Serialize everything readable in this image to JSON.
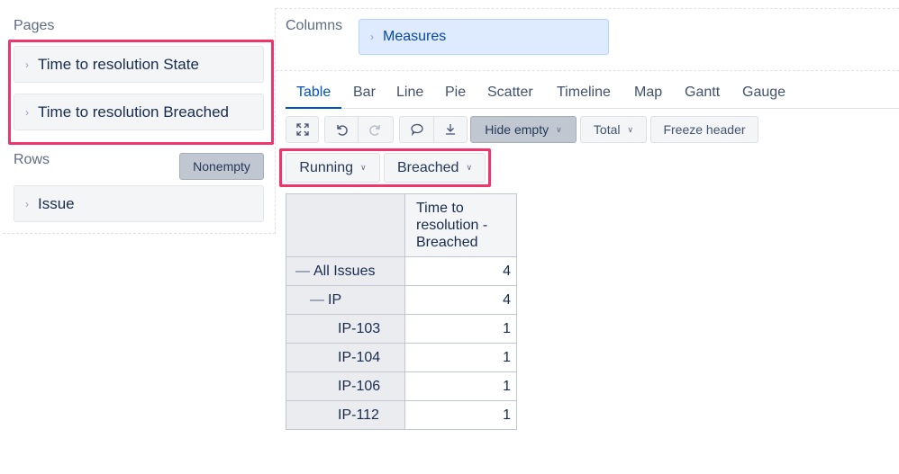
{
  "left": {
    "pages_title": "Pages",
    "pages_items": [
      "Time to resolution State",
      "Time to resolution Breached"
    ],
    "rows_title": "Rows",
    "nonempty_label": "Nonempty",
    "rows_items": [
      "Issue"
    ]
  },
  "columns": {
    "title": "Columns",
    "measures_label": "Measures"
  },
  "tabs": [
    "Table",
    "Bar",
    "Line",
    "Pie",
    "Scatter",
    "Timeline",
    "Map",
    "Gantt",
    "Gauge"
  ],
  "active_tab": "Table",
  "toolbar": {
    "hide_empty_label": "Hide empty",
    "total_label": "Total",
    "freeze_header_label": "Freeze header"
  },
  "filters": {
    "running_label": "Running",
    "breached_label": "Breached"
  },
  "table": {
    "column_header": "Time to resolution - Breached",
    "rows": [
      {
        "label": "All Issues",
        "value": "4"
      },
      {
        "label": "IP",
        "value": "4"
      },
      {
        "label": "IP-103",
        "value": "1"
      },
      {
        "label": "IP-104",
        "value": "1"
      },
      {
        "label": "IP-106",
        "value": "1"
      },
      {
        "label": "IP-112",
        "value": "1"
      }
    ]
  },
  "colors": {
    "highlight": "#f0346c",
    "accent": "#0052cc",
    "measures_bg": "#deebff"
  }
}
